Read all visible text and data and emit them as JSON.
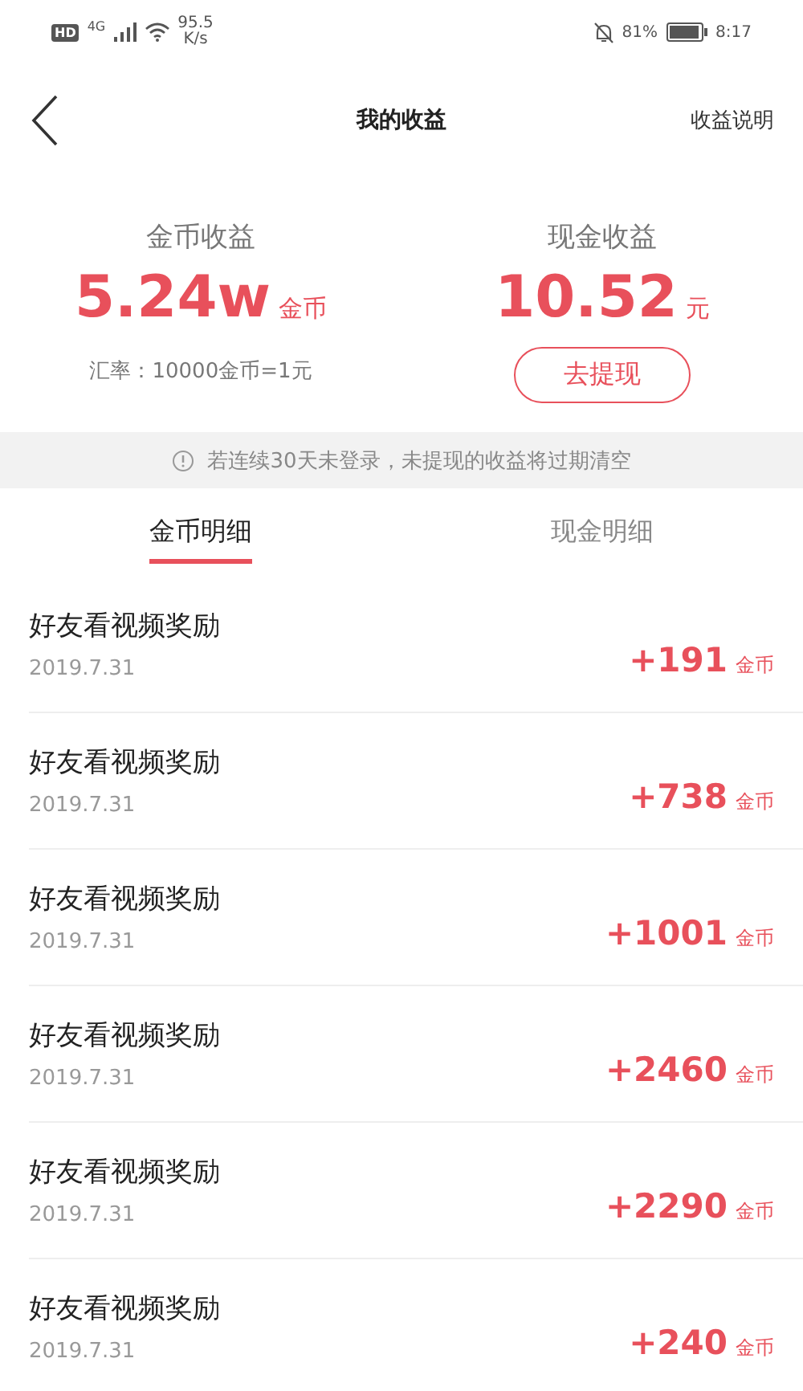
{
  "status_bar": {
    "left": {
      "hd": "HD",
      "network": "4G",
      "speed_value": "95.5",
      "speed_unit": "K/s"
    },
    "right": {
      "battery_percent": "81%",
      "time": "8:17"
    }
  },
  "nav": {
    "title": "我的收益",
    "action": "收益说明"
  },
  "summary": [
    {
      "label": "金币收益",
      "value": "5.24w",
      "unit": "金币",
      "note": "汇率：10000金币=1元",
      "kind": "note"
    },
    {
      "label": "现金收益",
      "value": "10.52",
      "unit": "元",
      "button": "去提现",
      "kind": "button"
    }
  ],
  "notice": "若连续30天未登录，未提现的收益将过期清空",
  "tabs": [
    {
      "label": "金币明细",
      "selected": true
    },
    {
      "label": "现金明细",
      "selected": false
    }
  ],
  "records": [
    {
      "title": "好友看视频奖励",
      "date": "2019.7.31",
      "amount": "+191",
      "unit": "金币"
    },
    {
      "title": "好友看视频奖励",
      "date": "2019.7.31",
      "amount": "+738",
      "unit": "金币"
    },
    {
      "title": "好友看视频奖励",
      "date": "2019.7.31",
      "amount": "+1001",
      "unit": "金币"
    },
    {
      "title": "好友看视频奖励",
      "date": "2019.7.31",
      "amount": "+2460",
      "unit": "金币"
    },
    {
      "title": "好友看视频奖励",
      "date": "2019.7.31",
      "amount": "+2290",
      "unit": "金币"
    },
    {
      "title": "好友看视频奖励",
      "date": "2019.7.31",
      "amount": "+240",
      "unit": "金币"
    }
  ]
}
